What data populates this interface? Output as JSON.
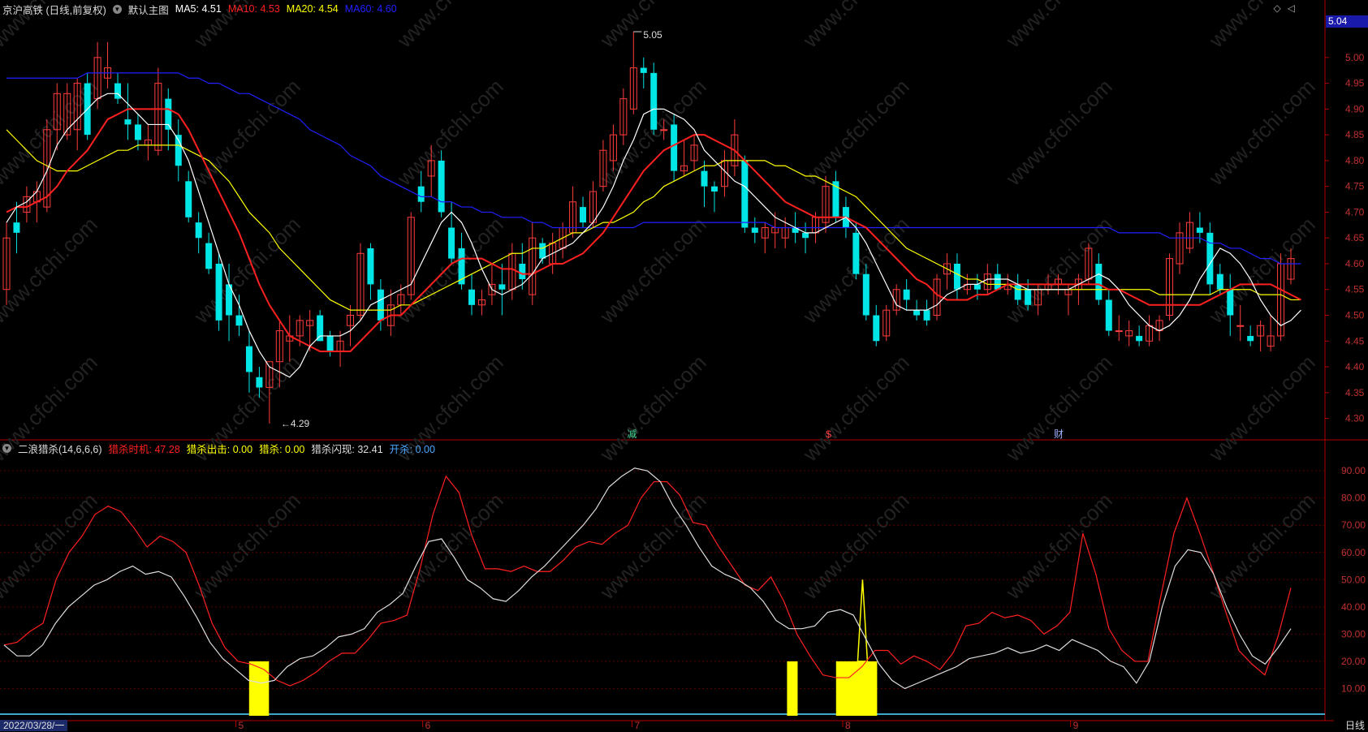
{
  "header": {
    "stock": "京沪高铁 (日线,前复权)",
    "main_chart_label": "默认主图",
    "ma5": {
      "label": "MA5:",
      "value": "4.51",
      "color": "#ffffff"
    },
    "ma10": {
      "label": "MA10:",
      "value": "4.53",
      "color": "#ff2020"
    },
    "ma20": {
      "label": "MA20:",
      "value": "4.54",
      "color": "#ffff00"
    },
    "ma60": {
      "label": "MA60:",
      "value": "4.60",
      "color": "#2020ff"
    }
  },
  "indicator_header": {
    "name": "二浪猎杀(14,6,6,6)",
    "items": [
      {
        "label": "猎杀时机:",
        "value": "47.28",
        "color": "#ff2020"
      },
      {
        "label": "猎杀出击:",
        "value": "0.00",
        "color": "#ffff00"
      },
      {
        "label": "猎杀:",
        "value": "0.00",
        "color": "#ffff00"
      },
      {
        "label": "猎杀闪现:",
        "value": "32.41",
        "color": "#dddddd"
      },
      {
        "label": "开杀:",
        "value": "0.00",
        "color": "#4aa8ff"
      }
    ]
  },
  "price_tag": "5.04",
  "annotations": {
    "high": "5.05",
    "low": "4.29"
  },
  "markers": [
    "减",
    "$",
    "财"
  ],
  "price_axis": [
    "5.00",
    "4.95",
    "4.90",
    "4.85",
    "4.80",
    "4.75",
    "4.70",
    "4.65",
    "4.60",
    "4.55",
    "4.50",
    "4.45",
    "4.40",
    "4.35",
    "4.30"
  ],
  "indicator_axis": [
    "90.00",
    "80.00",
    "70.00",
    "60.00",
    "50.00",
    "40.00",
    "30.00",
    "20.00",
    "10.00"
  ],
  "month_labels": [
    "5",
    "6",
    "7",
    "8",
    "9"
  ],
  "date_label": "2022/03/28/一",
  "period_label": "日线",
  "watermark": "www.cfchi.com",
  "chart_data": {
    "type": "candlestick",
    "candles": [
      [
        4.55,
        4.68,
        4.52,
        4.65
      ],
      [
        4.68,
        4.72,
        4.62,
        4.66
      ],
      [
        4.7,
        4.75,
        4.68,
        4.73
      ],
      [
        4.72,
        4.76,
        4.68,
        4.74
      ],
      [
        4.71,
        4.88,
        4.7,
        4.86
      ],
      [
        4.86,
        4.95,
        4.82,
        4.93
      ],
      [
        4.85,
        4.95,
        4.84,
        4.93
      ],
      [
        4.86,
        4.96,
        4.82,
        4.95
      ],
      [
        4.95,
        4.97,
        4.84,
        4.85
      ],
      [
        4.92,
        5.03,
        4.9,
        5.0
      ],
      [
        4.96,
        5.03,
        4.94,
        4.98
      ],
      [
        4.95,
        4.97,
        4.91,
        4.92
      ],
      [
        4.88,
        4.95,
        4.84,
        4.87
      ],
      [
        4.87,
        4.89,
        4.82,
        4.84
      ],
      [
        4.83,
        4.87,
        4.8,
        4.84
      ],
      [
        4.82,
        4.98,
        4.81,
        4.95
      ],
      [
        4.92,
        4.94,
        4.82,
        4.86
      ],
      [
        4.85,
        4.88,
        4.76,
        4.79
      ],
      [
        4.76,
        4.78,
        4.68,
        4.69
      ],
      [
        4.68,
        4.7,
        4.62,
        4.65
      ],
      [
        4.64,
        4.66,
        4.58,
        4.59
      ],
      [
        4.6,
        4.62,
        4.47,
        4.49
      ],
      [
        4.56,
        4.6,
        4.45,
        4.5
      ],
      [
        4.5,
        4.54,
        4.46,
        4.48
      ],
      [
        4.44,
        4.47,
        4.35,
        4.39
      ],
      [
        4.38,
        4.4,
        4.34,
        4.36
      ],
      [
        4.36,
        4.4,
        4.29,
        4.41
      ],
      [
        4.41,
        4.49,
        4.36,
        4.47
      ],
      [
        4.45,
        4.5,
        4.41,
        4.46
      ],
      [
        4.46,
        4.5,
        4.44,
        4.49
      ],
      [
        4.48,
        4.51,
        4.43,
        4.49
      ],
      [
        4.5,
        4.51,
        4.45,
        4.45
      ],
      [
        4.46,
        4.47,
        4.42,
        4.43
      ],
      [
        4.43,
        4.47,
        4.4,
        4.45
      ],
      [
        4.48,
        4.52,
        4.44,
        4.5
      ],
      [
        4.5,
        4.64,
        4.49,
        4.62
      ],
      [
        4.63,
        4.64,
        4.53,
        4.56
      ],
      [
        4.55,
        4.57,
        4.47,
        4.49
      ],
      [
        4.48,
        4.55,
        4.46,
        4.52
      ],
      [
        4.52,
        4.56,
        4.5,
        4.54
      ],
      [
        4.54,
        4.7,
        4.53,
        4.69
      ],
      [
        4.75,
        4.78,
        4.7,
        4.72
      ],
      [
        4.77,
        4.83,
        4.73,
        4.8
      ],
      [
        4.8,
        4.82,
        4.69,
        4.7
      ],
      [
        4.67,
        4.72,
        4.6,
        4.61
      ],
      [
        4.63,
        4.66,
        4.55,
        4.56
      ],
      [
        4.55,
        4.58,
        4.5,
        4.52
      ],
      [
        4.52,
        4.55,
        4.5,
        4.53
      ],
      [
        4.54,
        4.6,
        4.52,
        4.56
      ],
      [
        4.56,
        4.6,
        4.5,
        4.55
      ],
      [
        4.55,
        4.64,
        4.53,
        4.62
      ],
      [
        4.6,
        4.64,
        4.55,
        4.57
      ],
      [
        4.54,
        4.68,
        4.52,
        4.65
      ],
      [
        4.64,
        4.65,
        4.6,
        4.61
      ],
      [
        4.6,
        4.66,
        4.58,
        4.64
      ],
      [
        4.63,
        4.68,
        4.61,
        4.67
      ],
      [
        4.66,
        4.75,
        4.65,
        4.72
      ],
      [
        4.71,
        4.73,
        4.67,
        4.68
      ],
      [
        4.68,
        4.76,
        4.67,
        4.74
      ],
      [
        4.75,
        4.84,
        4.74,
        4.82
      ],
      [
        4.8,
        4.87,
        4.78,
        4.85
      ],
      [
        4.85,
        4.94,
        4.83,
        4.92
      ],
      [
        4.9,
        5.05,
        4.89,
        4.98
      ],
      [
        4.98,
        5.0,
        4.94,
        4.97
      ],
      [
        4.97,
        4.99,
        4.85,
        4.86
      ],
      [
        4.86,
        4.88,
        4.84,
        4.86
      ],
      [
        4.87,
        4.89,
        4.76,
        4.78
      ],
      [
        4.78,
        4.84,
        4.77,
        4.79
      ],
      [
        4.8,
        4.85,
        4.78,
        4.83
      ],
      [
        4.78,
        4.8,
        4.71,
        4.75
      ],
      [
        4.75,
        4.76,
        4.7,
        4.74
      ],
      [
        4.75,
        4.82,
        4.73,
        4.8
      ],
      [
        4.79,
        4.88,
        4.77,
        4.85
      ],
      [
        4.8,
        4.81,
        4.66,
        4.67
      ],
      [
        4.67,
        4.69,
        4.64,
        4.66
      ],
      [
        4.65,
        4.68,
        4.62,
        4.67
      ],
      [
        4.66,
        4.7,
        4.63,
        4.67
      ],
      [
        4.65,
        4.69,
        4.63,
        4.67
      ],
      [
        4.67,
        4.7,
        4.64,
        4.66
      ],
      [
        4.66,
        4.68,
        4.62,
        4.65
      ],
      [
        4.66,
        4.7,
        4.64,
        4.69
      ],
      [
        4.68,
        4.77,
        4.66,
        4.75
      ],
      [
        4.76,
        4.78,
        4.68,
        4.69
      ],
      [
        4.71,
        4.73,
        4.65,
        4.67
      ],
      [
        4.66,
        4.68,
        4.57,
        4.58
      ],
      [
        4.58,
        4.6,
        4.49,
        4.5
      ],
      [
        4.5,
        4.52,
        4.44,
        4.45
      ],
      [
        4.46,
        4.52,
        4.45,
        4.51
      ],
      [
        4.51,
        4.56,
        4.5,
        4.55
      ],
      [
        4.55,
        4.57,
        4.51,
        4.53
      ],
      [
        4.51,
        4.53,
        4.49,
        4.5
      ],
      [
        4.51,
        4.53,
        4.48,
        4.49
      ],
      [
        4.5,
        4.58,
        4.49,
        4.57
      ],
      [
        4.58,
        4.62,
        4.55,
        4.6
      ],
      [
        4.6,
        4.62,
        4.53,
        4.55
      ],
      [
        4.55,
        4.58,
        4.54,
        4.56
      ],
      [
        4.56,
        4.58,
        4.53,
        4.55
      ],
      [
        4.55,
        4.6,
        4.54,
        4.58
      ],
      [
        4.58,
        4.6,
        4.55,
        4.55
      ],
      [
        4.55,
        4.58,
        4.54,
        4.56
      ],
      [
        4.56,
        4.58,
        4.52,
        4.53
      ],
      [
        4.55,
        4.57,
        4.51,
        4.52
      ],
      [
        4.52,
        4.56,
        4.5,
        4.55
      ],
      [
        4.55,
        4.58,
        4.54,
        4.56
      ],
      [
        4.56,
        4.58,
        4.54,
        4.57
      ],
      [
        4.54,
        4.56,
        4.5,
        4.55
      ],
      [
        4.55,
        4.58,
        4.52,
        4.57
      ],
      [
        4.57,
        4.64,
        4.56,
        4.63
      ],
      [
        4.6,
        4.62,
        4.52,
        4.53
      ],
      [
        4.53,
        4.55,
        4.46,
        4.47
      ],
      [
        4.47,
        4.5,
        4.45,
        4.47
      ],
      [
        4.46,
        4.49,
        4.44,
        4.47
      ],
      [
        4.46,
        4.48,
        4.44,
        4.45
      ],
      [
        4.45,
        4.5,
        4.44,
        4.48
      ],
      [
        4.47,
        4.5,
        4.45,
        4.49
      ],
      [
        4.5,
        4.62,
        4.49,
        4.61
      ],
      [
        4.6,
        4.68,
        4.58,
        4.66
      ],
      [
        4.63,
        4.7,
        4.62,
        4.68
      ],
      [
        4.67,
        4.7,
        4.64,
        4.66
      ],
      [
        4.66,
        4.68,
        4.54,
        4.56
      ],
      [
        4.58,
        4.6,
        4.54,
        4.55
      ],
      [
        4.55,
        4.58,
        4.46,
        4.5
      ],
      [
        4.48,
        4.52,
        4.45,
        4.48
      ],
      [
        4.46,
        4.48,
        4.44,
        4.45
      ],
      [
        4.46,
        4.49,
        4.43,
        4.48
      ],
      [
        4.44,
        4.5,
        4.43,
        4.46
      ],
      [
        4.46,
        4.62,
        4.45,
        4.6
      ],
      [
        4.57,
        4.63,
        4.56,
        4.61
      ]
    ],
    "ma5": [
      4.68,
      4.71,
      4.72,
      4.74,
      4.78,
      4.83,
      4.86,
      4.88,
      4.9,
      4.92,
      4.93,
      4.93,
      4.91,
      4.89,
      4.87,
      4.87,
      4.87,
      4.84,
      4.8,
      4.74,
      4.68,
      4.62,
      4.56,
      4.52,
      4.47,
      4.43,
      4.4,
      4.39,
      4.38,
      4.4,
      4.44,
      4.46,
      4.46,
      4.46,
      4.47,
      4.49,
      4.52,
      4.53,
      4.54,
      4.55,
      4.56,
      4.6,
      4.64,
      4.68,
      4.7,
      4.68,
      4.64,
      4.59,
      4.55,
      4.54,
      4.55,
      4.56,
      4.58,
      4.61,
      4.62,
      4.63,
      4.64,
      4.66,
      4.68,
      4.71,
      4.75,
      4.8,
      4.84,
      4.89,
      4.9,
      4.9,
      4.89,
      4.88,
      4.86,
      4.82,
      4.8,
      4.78,
      4.76,
      4.75,
      4.73,
      4.71,
      4.69,
      4.68,
      4.67,
      4.66,
      4.66,
      4.67,
      4.68,
      4.69,
      4.67,
      4.64,
      4.6,
      4.56,
      4.52,
      4.51,
      4.51,
      4.51,
      4.52,
      4.54,
      4.55,
      4.56,
      4.56,
      4.57,
      4.57,
      4.57,
      4.56,
      4.55,
      4.55,
      4.55,
      4.55,
      4.55,
      4.56,
      4.57,
      4.58,
      4.57,
      4.55,
      4.52,
      4.5,
      4.48,
      4.47,
      4.48,
      4.5,
      4.53,
      4.57,
      4.6,
      4.63,
      4.62,
      4.6,
      4.57,
      4.53,
      4.5,
      4.48,
      4.49,
      4.51
    ],
    "ma10": [
      4.7,
      4.71,
      4.71,
      4.72,
      4.73,
      4.75,
      4.78,
      4.8,
      4.82,
      4.85,
      4.88,
      4.89,
      4.9,
      4.9,
      4.9,
      4.9,
      4.9,
      4.89,
      4.86,
      4.82,
      4.78,
      4.74,
      4.7,
      4.66,
      4.61,
      4.56,
      4.52,
      4.49,
      4.46,
      4.45,
      4.44,
      4.43,
      4.43,
      4.43,
      4.43,
      4.45,
      4.47,
      4.49,
      4.5,
      4.5,
      4.52,
      4.54,
      4.56,
      4.58,
      4.6,
      4.61,
      4.61,
      4.61,
      4.6,
      4.59,
      4.59,
      4.58,
      4.58,
      4.59,
      4.6,
      4.6,
      4.61,
      4.62,
      4.64,
      4.66,
      4.69,
      4.72,
      4.75,
      4.78,
      4.8,
      4.82,
      4.83,
      4.84,
      4.85,
      4.85,
      4.84,
      4.83,
      4.82,
      4.8,
      4.78,
      4.76,
      4.74,
      4.72,
      4.71,
      4.7,
      4.69,
      4.69,
      4.69,
      4.69,
      4.68,
      4.67,
      4.65,
      4.63,
      4.61,
      4.59,
      4.57,
      4.56,
      4.54,
      4.53,
      4.53,
      4.53,
      4.54,
      4.54,
      4.55,
      4.56,
      4.56,
      4.56,
      4.56,
      4.56,
      4.56,
      4.56,
      4.56,
      4.56,
      4.56,
      4.55,
      4.55,
      4.54,
      4.53,
      4.52,
      4.52,
      4.52,
      4.52,
      4.52,
      4.52,
      4.53,
      4.54,
      4.55,
      4.56,
      4.56,
      4.56,
      4.56,
      4.55,
      4.54,
      4.53
    ],
    "ma20": [
      4.86,
      4.84,
      4.82,
      4.8,
      4.79,
      4.78,
      4.78,
      4.78,
      4.79,
      4.8,
      4.81,
      4.82,
      4.82,
      4.83,
      4.83,
      4.83,
      4.83,
      4.83,
      4.82,
      4.81,
      4.8,
      4.78,
      4.76,
      4.73,
      4.7,
      4.68,
      4.66,
      4.63,
      4.61,
      4.59,
      4.57,
      4.55,
      4.53,
      4.52,
      4.51,
      4.51,
      4.51,
      4.51,
      4.51,
      4.52,
      4.52,
      4.53,
      4.54,
      4.55,
      4.56,
      4.57,
      4.58,
      4.59,
      4.6,
      4.61,
      4.62,
      4.62,
      4.63,
      4.63,
      4.64,
      4.65,
      4.66,
      4.66,
      4.67,
      4.68,
      4.68,
      4.69,
      4.7,
      4.72,
      4.73,
      4.75,
      4.76,
      4.77,
      4.78,
      4.79,
      4.79,
      4.8,
      4.8,
      4.8,
      4.8,
      4.8,
      4.79,
      4.79,
      4.78,
      4.77,
      4.77,
      4.76,
      4.75,
      4.74,
      4.73,
      4.71,
      4.69,
      4.67,
      4.65,
      4.63,
      4.62,
      4.61,
      4.6,
      4.59,
      4.58,
      4.57,
      4.57,
      4.56,
      4.56,
      4.56,
      4.55,
      4.55,
      4.55,
      4.55,
      4.55,
      4.55,
      4.55,
      4.55,
      4.55,
      4.55,
      4.55,
      4.55,
      4.55,
      4.55,
      4.54,
      4.54,
      4.54,
      4.54,
      4.54,
      4.54,
      4.55,
      4.55,
      4.55,
      4.55,
      4.54,
      4.54,
      4.54,
      4.53,
      4.53
    ],
    "ma60": [
      4.96,
      4.96,
      4.96,
      4.96,
      4.96,
      4.96,
      4.96,
      4.96,
      4.97,
      4.97,
      4.97,
      4.97,
      4.97,
      4.97,
      4.97,
      4.97,
      4.97,
      4.97,
      4.96,
      4.96,
      4.95,
      4.95,
      4.94,
      4.93,
      4.93,
      4.92,
      4.91,
      4.9,
      4.89,
      4.88,
      4.86,
      4.85,
      4.84,
      4.83,
      4.81,
      4.8,
      4.79,
      4.77,
      4.76,
      4.75,
      4.74,
      4.73,
      4.73,
      4.72,
      4.72,
      4.71,
      4.71,
      4.7,
      4.7,
      4.69,
      4.69,
      4.69,
      4.68,
      4.68,
      4.67,
      4.67,
      4.67,
      4.67,
      4.67,
      4.67,
      4.67,
      4.67,
      4.67,
      4.68,
      4.68,
      4.68,
      4.68,
      4.68,
      4.68,
      4.68,
      4.68,
      4.68,
      4.68,
      4.68,
      4.68,
      4.68,
      4.67,
      4.67,
      4.67,
      4.67,
      4.67,
      4.67,
      4.67,
      4.67,
      4.67,
      4.67,
      4.67,
      4.67,
      4.67,
      4.67,
      4.67,
      4.67,
      4.67,
      4.67,
      4.67,
      4.67,
      4.67,
      4.67,
      4.67,
      4.67,
      4.67,
      4.67,
      4.67,
      4.67,
      4.67,
      4.67,
      4.67,
      4.67,
      4.67,
      4.67,
      4.66,
      4.66,
      4.66,
      4.66,
      4.66,
      4.65,
      4.65,
      4.65,
      4.65,
      4.64,
      4.64,
      4.63,
      4.63,
      4.62,
      4.61,
      4.61,
      4.6,
      4.6,
      4.6
    ],
    "price_range": [
      4.26,
      5.08
    ],
    "indicator_range": [
      0,
      96
    ],
    "shijī": [
      26,
      27,
      31,
      34,
      50,
      60,
      66,
      74,
      77,
      75,
      69,
      62,
      66,
      64,
      60,
      48,
      34,
      25,
      20,
      19,
      17,
      13,
      11,
      13,
      16,
      20,
      23,
      23,
      28,
      34,
      35,
      37,
      54,
      74,
      88,
      82,
      66,
      54,
      54,
      53,
      55,
      53,
      53,
      57,
      62,
      64,
      63,
      67,
      70,
      80,
      86,
      86,
      81,
      71,
      70,
      62,
      55,
      48,
      46,
      51,
      42,
      30,
      22,
      15,
      14,
      14,
      18,
      24,
      24,
      19,
      22,
      20,
      17,
      23,
      33,
      34,
      38,
      36,
      37,
      35,
      30,
      33,
      38,
      67,
      52,
      32,
      24,
      20,
      20,
      44,
      67,
      80,
      67,
      53,
      38,
      24,
      19,
      15,
      29,
      47
    ],
    "shanxian": [
      26,
      22,
      22,
      26,
      34,
      40,
      44,
      48,
      50,
      53,
      55,
      52,
      53,
      51,
      44,
      36,
      27,
      21,
      17,
      13,
      12,
      13,
      18,
      21,
      22,
      25,
      29,
      30,
      32,
      38,
      41,
      45,
      55,
      64,
      65,
      58,
      50,
      47,
      43,
      42,
      46,
      51,
      55,
      60,
      65,
      70,
      76,
      84,
      88,
      91,
      90,
      86,
      77,
      70,
      62,
      55,
      52,
      50,
      47,
      42,
      35,
      32,
      32,
      33,
      38,
      39,
      37,
      28,
      19,
      13,
      10,
      12,
      14,
      16,
      18,
      21,
      22,
      23,
      25,
      23,
      24,
      26,
      24,
      28,
      26,
      24,
      20,
      18,
      12,
      20,
      40,
      55,
      61,
      60,
      52,
      40,
      30,
      22,
      19,
      25,
      32
    ],
    "yellow_bars": [
      {
        "start": 0.188,
        "end": 0.203,
        "height": 20
      },
      {
        "start": 0.594,
        "end": 0.602,
        "height": 20
      },
      {
        "start": 0.631,
        "end": 0.662,
        "height": 20
      }
    ],
    "yellow_spike": {
      "pos": 0.651,
      "peak": 50
    }
  }
}
